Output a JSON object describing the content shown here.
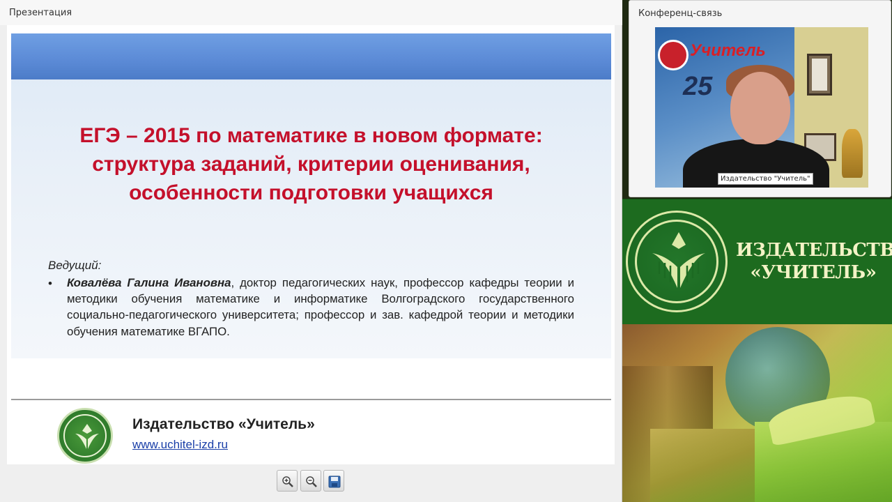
{
  "presentation": {
    "panel_title": "Презентация",
    "slide": {
      "title_lines": [
        "ЕГЭ – 2015 по математике в новом формате:",
        "структура заданий, критерии оценивания,",
        "особенности подготовки учащихся"
      ],
      "host_label": "Ведущий:",
      "host_name": "Ковалёва Галина Ивановна",
      "host_description": ", доктор педагогических наук, профессор кафедры теории и методики обучения математике и информатике Волгоградского государственного социально-педагогического университета; профессор и зав. кафедрой теории и методики обучения математике ВГАПО.",
      "publisher_name": "Издательство «Учитель»",
      "publisher_url": "www.uchitel-izd.ru"
    },
    "toolbar": {
      "zoom_in_icon": "zoom-in-icon",
      "zoom_out_icon": "zoom-out-icon",
      "save_icon": "save-icon"
    }
  },
  "conference": {
    "panel_title": "Конференц-связь",
    "video_caption": "Издательство \"Учитель\"",
    "banner_text": "Учитель",
    "banner_number": "25"
  },
  "publisher_banner": {
    "line1": "ИЗДАТЕЛЬСТВО",
    "line2": "«УЧИТЕЛЬ»"
  },
  "colors": {
    "slide_title": "#c4102b",
    "publisher_green": "#1d6b1f",
    "publisher_text": "#f4f3c6",
    "link": "#1a3fa8"
  }
}
